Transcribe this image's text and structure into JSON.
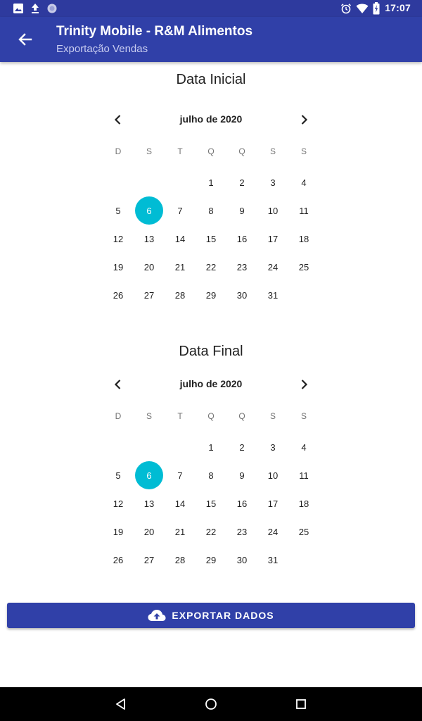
{
  "status_bar": {
    "time": "17:07",
    "left_icons": [
      "image-icon",
      "upload-icon",
      "sync-icon"
    ],
    "right_icons": [
      "alarm-icon",
      "wifi-icon",
      "battery-icon"
    ]
  },
  "app_bar": {
    "title": "Trinity Mobile - R&M Alimentos",
    "subtitle": "Exportação Vendas",
    "back_icon": "arrow-left-icon"
  },
  "calendars": [
    {
      "title": "Data Inicial",
      "month_label": "julho de 2020",
      "weekdays": [
        "D",
        "S",
        "T",
        "Q",
        "Q",
        "S",
        "S"
      ],
      "selected_day": "6",
      "weeks": [
        [
          "",
          "",
          "",
          "1",
          "2",
          "3",
          "4"
        ],
        [
          "5",
          "6",
          "7",
          "8",
          "9",
          "10",
          "11"
        ],
        [
          "12",
          "13",
          "14",
          "15",
          "16",
          "17",
          "18"
        ],
        [
          "19",
          "20",
          "21",
          "22",
          "23",
          "24",
          "25"
        ],
        [
          "26",
          "27",
          "28",
          "29",
          "30",
          "31",
          ""
        ]
      ]
    },
    {
      "title": "Data Final",
      "month_label": "julho de 2020",
      "weekdays": [
        "D",
        "S",
        "T",
        "Q",
        "Q",
        "S",
        "S"
      ],
      "selected_day": "6",
      "weeks": [
        [
          "",
          "",
          "",
          "1",
          "2",
          "3",
          "4"
        ],
        [
          "5",
          "6",
          "7",
          "8",
          "9",
          "10",
          "11"
        ],
        [
          "12",
          "13",
          "14",
          "15",
          "16",
          "17",
          "18"
        ],
        [
          "19",
          "20",
          "21",
          "22",
          "23",
          "24",
          "25"
        ],
        [
          "26",
          "27",
          "28",
          "29",
          "30",
          "31",
          ""
        ]
      ]
    }
  ],
  "export_button": {
    "label": "EXPORTAR DADOS",
    "icon": "cloud-upload-icon"
  },
  "nav_bar": {
    "icons": [
      "back-triangle-icon",
      "home-circle-icon",
      "recents-square-icon"
    ]
  },
  "colors": {
    "primary": "#3040a8",
    "status_bar": "#2e3a9e",
    "accent": "#00bcd4"
  }
}
